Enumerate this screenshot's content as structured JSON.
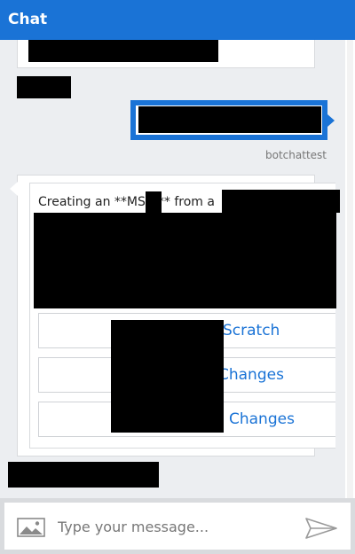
{
  "header": {
    "title": "Chat"
  },
  "messages": {
    "user_sender": "botchattest",
    "bot_text": "Creating an **MS A** from a",
    "actions": [
      {
        "label": "Scratch"
      },
      {
        "label": "Changes"
      },
      {
        "label": "Changes"
      }
    ]
  },
  "composer": {
    "placeholder": "Type your message...",
    "attach_icon": "image-icon",
    "send_icon": "send-icon"
  },
  "colors": {
    "accent": "#1a73d6",
    "history_bg": "#eceef1",
    "link": "#1a73d6"
  }
}
